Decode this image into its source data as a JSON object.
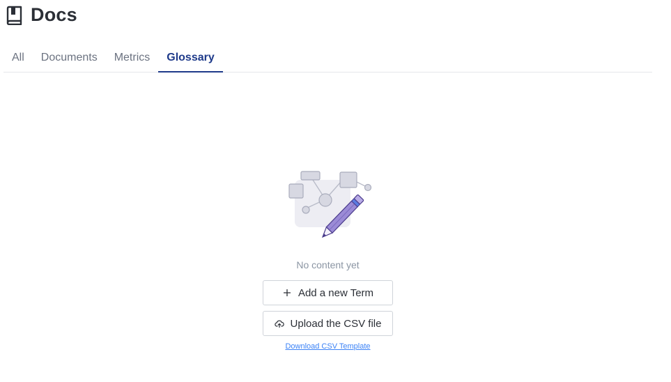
{
  "header": {
    "title": "Docs",
    "icon": "book-icon"
  },
  "tabs": [
    {
      "label": "All",
      "active": false
    },
    {
      "label": "Documents",
      "active": false
    },
    {
      "label": "Metrics",
      "active": false
    },
    {
      "label": "Glossary",
      "active": true
    }
  ],
  "empty_state": {
    "illustration": "diagram-with-pencil-illustration",
    "message": "No content yet",
    "add_term_button": {
      "label": "Add a new Term",
      "icon": "plus-icon"
    },
    "upload_button": {
      "label": "Upload the CSV file",
      "icon": "cloud-upload-icon"
    },
    "download_link": "Download CSV Template"
  },
  "colors": {
    "active_tab": "#1e3a8a",
    "link": "#3b82f6",
    "illustration_purple": "#9b8bd6"
  }
}
